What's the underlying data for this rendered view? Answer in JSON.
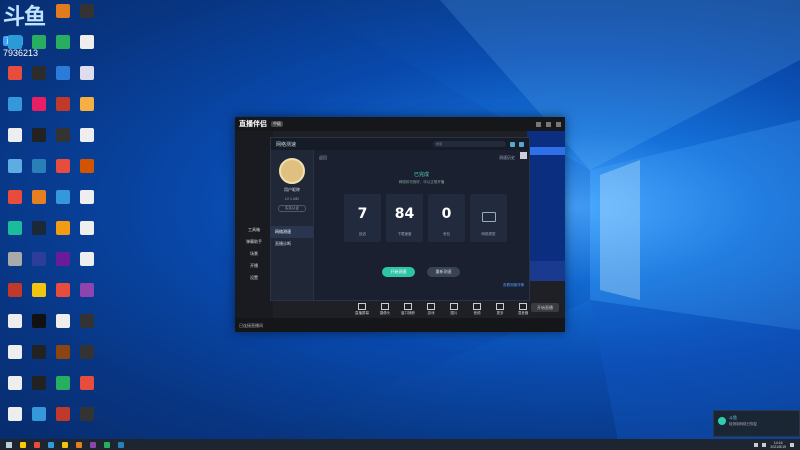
{
  "desktop": {
    "live_badge": {
      "mark": "斗鱼",
      "chip": "直播",
      "room_number": "7936213"
    },
    "icons": [
      {
        "label": "",
        "color": "#c0392b"
      },
      {
        "label": "",
        "color": "#7a5a3a"
      },
      {
        "label": "",
        "color": "#e07b20"
      },
      {
        "label": "",
        "color": "#333"
      },
      {
        "label": "",
        "color": "#2b9bd8"
      },
      {
        "label": "",
        "color": "#27ae60"
      },
      {
        "label": "",
        "color": "#27ae60"
      },
      {
        "label": "",
        "color": "#eee"
      },
      {
        "label": "",
        "color": "#e74c3c"
      },
      {
        "label": "",
        "color": "#2c2c2c"
      },
      {
        "label": "",
        "color": "#2b7bd8"
      },
      {
        "label": "",
        "color": "#dde"
      },
      {
        "label": "",
        "color": "#3498db"
      },
      {
        "label": "",
        "color": "#e91e63"
      },
      {
        "label": "",
        "color": "#c0392b"
      },
      {
        "label": "",
        "color": "#f5b041"
      },
      {
        "label": "",
        "color": "#eee"
      },
      {
        "label": "",
        "color": "#222"
      },
      {
        "label": "",
        "color": "#333"
      },
      {
        "label": "",
        "color": "#eee"
      },
      {
        "label": "",
        "color": "#5dade2"
      },
      {
        "label": "",
        "color": "#2980b9"
      },
      {
        "label": "",
        "color": "#e74c3c"
      },
      {
        "label": "",
        "color": "#d35400"
      },
      {
        "label": "",
        "color": "#e74c3c"
      },
      {
        "label": "",
        "color": "#e67e22"
      },
      {
        "label": "",
        "color": "#3498db"
      },
      {
        "label": "",
        "color": "#eee"
      },
      {
        "label": "",
        "color": "#1abc9c"
      },
      {
        "label": "",
        "color": "#1b2838"
      },
      {
        "label": "",
        "color": "#f39c12"
      },
      {
        "label": "",
        "color": "#eee"
      },
      {
        "label": "",
        "color": "#aaa"
      },
      {
        "label": "",
        "color": "#2c3e9a"
      },
      {
        "label": "",
        "color": "#6a1b9a"
      },
      {
        "label": "",
        "color": "#eee"
      },
      {
        "label": "",
        "color": "#c0392b"
      },
      {
        "label": "",
        "color": "#f1c40f"
      },
      {
        "label": "",
        "color": "#e74c3c"
      },
      {
        "label": "",
        "color": "#8e44ad"
      },
      {
        "label": "",
        "color": "#eee"
      },
      {
        "label": "",
        "color": "#111"
      },
      {
        "label": "",
        "color": "#eee"
      },
      {
        "label": "",
        "color": "#333"
      },
      {
        "label": "",
        "color": "#eee"
      },
      {
        "label": "",
        "color": "#222"
      },
      {
        "label": "",
        "color": "#8b4513"
      },
      {
        "label": "",
        "color": "#333"
      },
      {
        "label": "",
        "color": "#eee"
      },
      {
        "label": "",
        "color": "#222"
      },
      {
        "label": "",
        "color": "#27ae60"
      },
      {
        "label": "",
        "color": "#e74c3c"
      },
      {
        "label": "",
        "color": "#eee"
      },
      {
        "label": "",
        "color": "#3498db"
      },
      {
        "label": "",
        "color": "#c0392b"
      },
      {
        "label": "",
        "color": "#333"
      }
    ]
  },
  "app_window": {
    "logo": "直播伴侣",
    "chip": "中级",
    "left_items": [
      "工具箱",
      "弹幕助手",
      "场景",
      "开播",
      "设置"
    ],
    "status_text": "已连接直播间",
    "toolbar": [
      "直播屏幕",
      "摄像头",
      "窗口捕获",
      "游戏",
      "图片",
      "音频",
      "更多",
      "混音器"
    ],
    "go_live_label": "开始直播"
  },
  "dialog": {
    "title": "网络测速",
    "search_placeholder": "搜索",
    "user": {
      "name": "用户昵称",
      "level": "LV 1 UID",
      "badge": "实名认证"
    },
    "menu": [
      {
        "label": "网络测速",
        "active": true
      },
      {
        "label": "直播诊断",
        "active": false
      }
    ],
    "back_label": "返回",
    "history_label": "测速历史",
    "status": "已完成",
    "subline": "网络状况良好，可以正常开播",
    "metrics": [
      {
        "value": "7",
        "label": "延迟"
      },
      {
        "value": "84",
        "label": "下载速度"
      },
      {
        "value": "0",
        "label": "丢包"
      },
      {
        "value": "",
        "label": "网络类型"
      }
    ],
    "primary_button": "开始测速",
    "secondary_button": "重新测速",
    "footer_link": "查看测速详情"
  },
  "taskbar": {
    "time": "14:16",
    "date": "2021/8/19",
    "app_colors": [
      "#ffcc00",
      "#e74c3c",
      "#3498db",
      "#f1c40f",
      "#e67e22",
      "#8e44ad",
      "#27ae60",
      "#2980b9"
    ]
  },
  "toast": {
    "title": "斗鱼",
    "desc": "检测到网络已恢复"
  }
}
